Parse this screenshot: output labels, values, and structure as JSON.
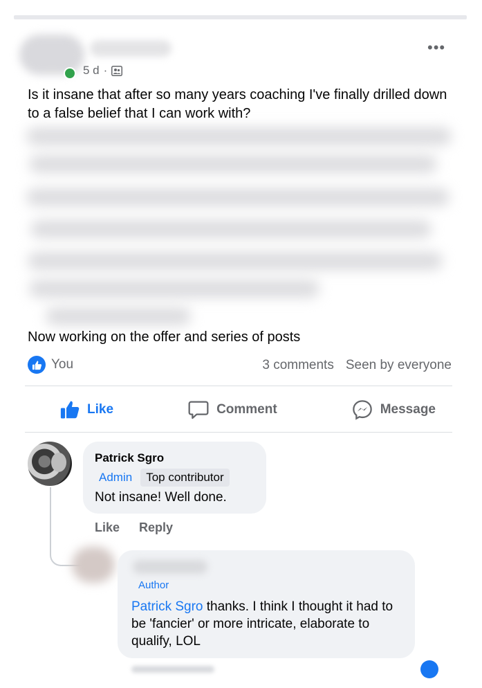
{
  "post": {
    "timestamp": "5 d",
    "separator": "·",
    "text_1": "Is it insane that after so many years coaching I've finally drilled down to a false belief that I can work with?",
    "text_2": "Now working on the offer and series of posts",
    "more_label": "•••"
  },
  "reactions": {
    "reactor": "You",
    "comments_count": "3 comments",
    "audience": "Seen by everyone"
  },
  "actions": {
    "like": "Like",
    "comment": "Comment",
    "message": "Message"
  },
  "comment_1": {
    "author": "Patrick Sgro",
    "badge_admin": "Admin",
    "badge_top": "Top contributor",
    "text": "Not insane! Well done.",
    "like": "Like",
    "reply": "Reply"
  },
  "reply_1": {
    "author_label": "Author",
    "mention": "Patrick Sgro",
    "text": " thanks. I think I thought it had to be 'fancier' or more intricate, elaborate to qualify, LOL"
  },
  "colors": {
    "accent": "#1877f2",
    "muted": "#65676b",
    "bubble": "#f0f2f5",
    "online": "#31a24c"
  }
}
